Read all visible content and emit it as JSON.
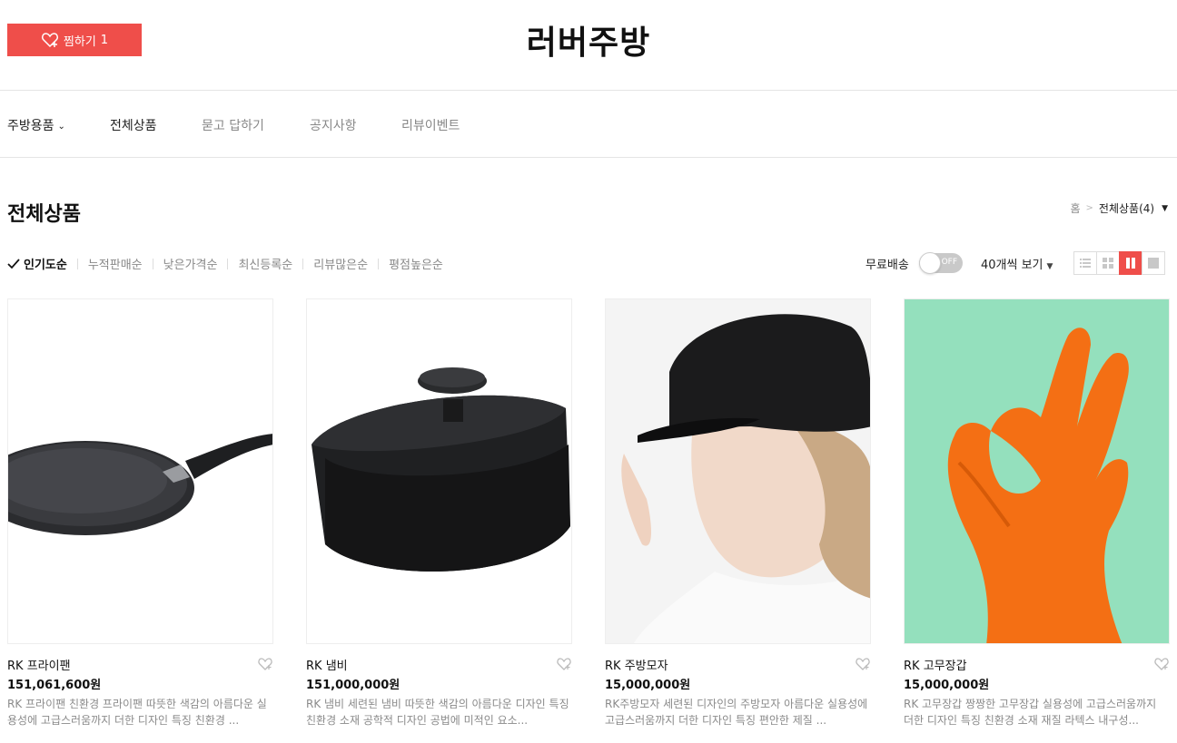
{
  "header": {
    "wish_label": "찜하기",
    "wish_count": "1",
    "logo": "러버주방"
  },
  "nav": {
    "items": [
      {
        "label": "주방용품"
      },
      {
        "label": "전체상품"
      },
      {
        "label": "묻고 답하기"
      },
      {
        "label": "공지사항"
      },
      {
        "label": "리뷰이벤트"
      }
    ]
  },
  "page_title": "전체상품",
  "breadcrumb": {
    "home": "홈",
    "current": "전체상품(4)"
  },
  "sorts": [
    "인기도순",
    "누적판매순",
    "낮은가격순",
    "최신등록순",
    "리뷰많은순",
    "평점높은순"
  ],
  "filters": {
    "free_shipping_label": "무료배송",
    "toggle_state": "OFF",
    "per_page": "40개씩 보기"
  },
  "colors": {
    "accent": "#ef4e4a",
    "muted_text": "#888888"
  },
  "products": [
    {
      "name": "RK 프라이팬",
      "price": "151,061,600원",
      "desc": "RK 프라이팬 친환경 프라이팬 따뜻한 색감의 아름다운 실용성에 고급스러움까지 더한 디자인 특징 친환경 ..."
    },
    {
      "name": "RK 냄비",
      "price": "151,000,000원",
      "desc": "RK 냄비 세련된 냄비 따뜻한 색감의 아름다운 디자인 특징 친환경 소재 공학적 디자인 공법에 미적인 요소..."
    },
    {
      "name": "RK 주방모자",
      "price": "15,000,000원",
      "desc": "RK주방모자 세련된 디자인의 주방모자 아름다운 실용성에 고급스러움까지 더한 디자인 특징 편안한 제질 ..."
    },
    {
      "name": "RK 고무장갑",
      "price": "15,000,000원",
      "desc": "RK 고무장갑 짱짱한 고무장갑 실용성에 고급스러움까지 더한 디자인 특징 친환경 소재 재질 라텍스 내구성..."
    }
  ]
}
